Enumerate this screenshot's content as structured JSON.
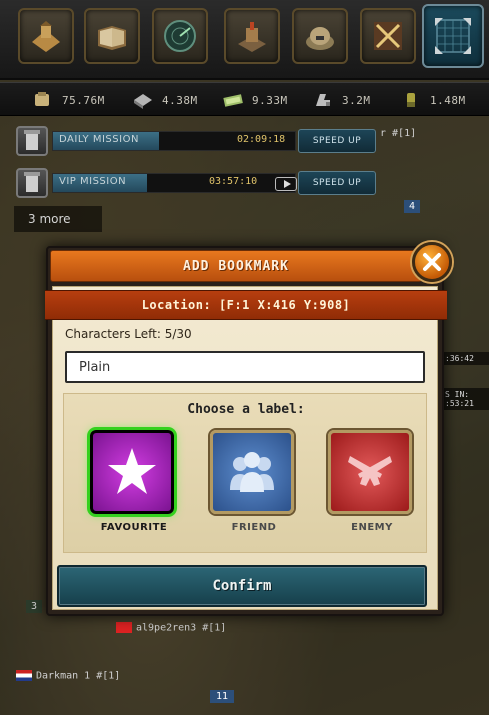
{
  "top_bar": {
    "icons": [
      "headquarters-icon",
      "book-icon",
      "radar-icon",
      "build-icon",
      "bunker-icon",
      "battle-icon",
      "map-icon"
    ]
  },
  "resources": [
    {
      "icon": "food-icon",
      "value": "75.76M"
    },
    {
      "icon": "steel-icon",
      "value": "4.38M"
    },
    {
      "icon": "money-icon",
      "value": "9.33M"
    },
    {
      "icon": "oil-icon",
      "value": "3.2M"
    },
    {
      "icon": "ammo-icon",
      "value": "1.48M"
    }
  ],
  "missions": [
    {
      "label": "DAILY MISSION",
      "time": "02:09:18",
      "button": "SPEED UP",
      "progress": 0.44
    },
    {
      "label": "VIP MISSION",
      "time": "03:57:10",
      "button": "SPEED UP",
      "progress": 0.39
    }
  ],
  "more_label": "3 more",
  "map_labels": {
    "player_top": "r #[1]",
    "marker_number": "4",
    "side_time": ":36:42",
    "side_status": "S IN:\n:53:21",
    "player_mid": "al9pe2ren3 #[1]",
    "player_bottom": "Darkman 1 #[1]",
    "badge_left": "3",
    "badge_bottom": "11"
  },
  "dialog": {
    "title": "ADD BOOKMARK",
    "location": "Location: [F:1  X:416  Y:908]",
    "characters_left": "Characters Left: 5/30",
    "input_value": "Plain",
    "choose_label": "Choose a label:",
    "labels": [
      {
        "name": "FAVOURITE",
        "icon": "star-icon",
        "selected": true,
        "color": "#a61fbf"
      },
      {
        "name": "FRIEND",
        "icon": "friends-icon",
        "selected": false,
        "color": "#4572b0"
      },
      {
        "name": "ENEMY",
        "icon": "crossed-pistols-icon",
        "selected": false,
        "color": "#c13434"
      }
    ],
    "confirm_label": "Confirm"
  },
  "colors": {
    "title_orange": "#d86a18",
    "location_red": "#a9360b",
    "confirm_teal": "#21545f",
    "paper": "#efe3c6"
  }
}
